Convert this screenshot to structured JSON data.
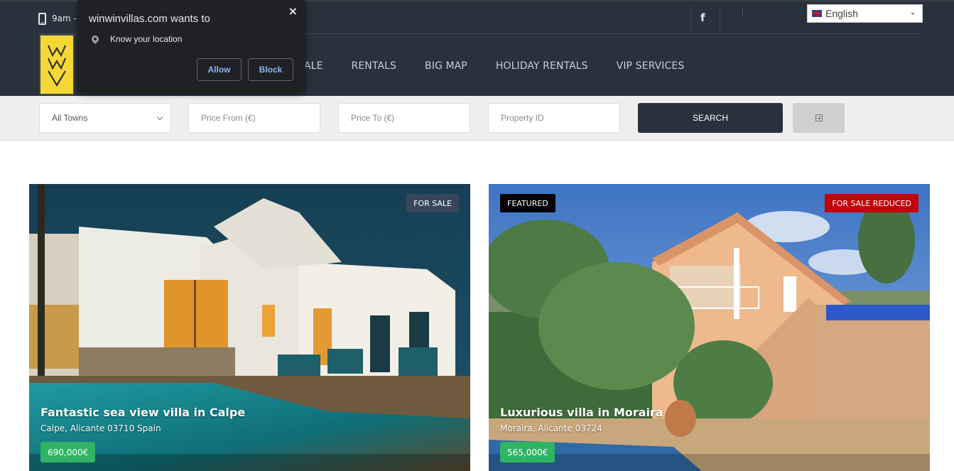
{
  "header": {
    "hours_text": "9am - ",
    "social": {
      "facebook_icon": "f"
    },
    "language": {
      "selected": "English",
      "flag": "uk-flag"
    },
    "nav": [
      {
        "label": "ALE"
      },
      {
        "label": "RENTALS"
      },
      {
        "label": "BIG MAP"
      },
      {
        "label": "HOLIDAY RENTALS"
      },
      {
        "label": "VIP SERVICES"
      }
    ]
  },
  "permission_popup": {
    "title": "winwinvillas.com wants to",
    "permission": "Know your location",
    "allow_label": "Allow",
    "block_label": "Block",
    "close_label": "×"
  },
  "search": {
    "town_selected": "All Towns",
    "price_from_placeholder": "Price From (€)",
    "price_to_placeholder": "Price To (€)",
    "property_id_placeholder": "Property ID",
    "search_label": "SEARCH"
  },
  "listings": [
    {
      "badges": [
        "FOR SALE"
      ],
      "title": "Fantastic sea view villa in Calpe",
      "address": "Calpe, Alicante 03710 Spain",
      "price": "690,000€"
    },
    {
      "badges": [
        "FEATURED",
        "FOR SALE REDUCED"
      ],
      "title": "Luxurious villa in Moraira",
      "address": "Moraira, Alicante 03724",
      "price": "565,000€"
    }
  ],
  "colors": {
    "header_bg": "#29313d",
    "logo_yellow": "#f5d835",
    "price_green": "#2fb463",
    "reduced_red": "#c3000a",
    "popup_link_blue": "#8ab4f8"
  }
}
